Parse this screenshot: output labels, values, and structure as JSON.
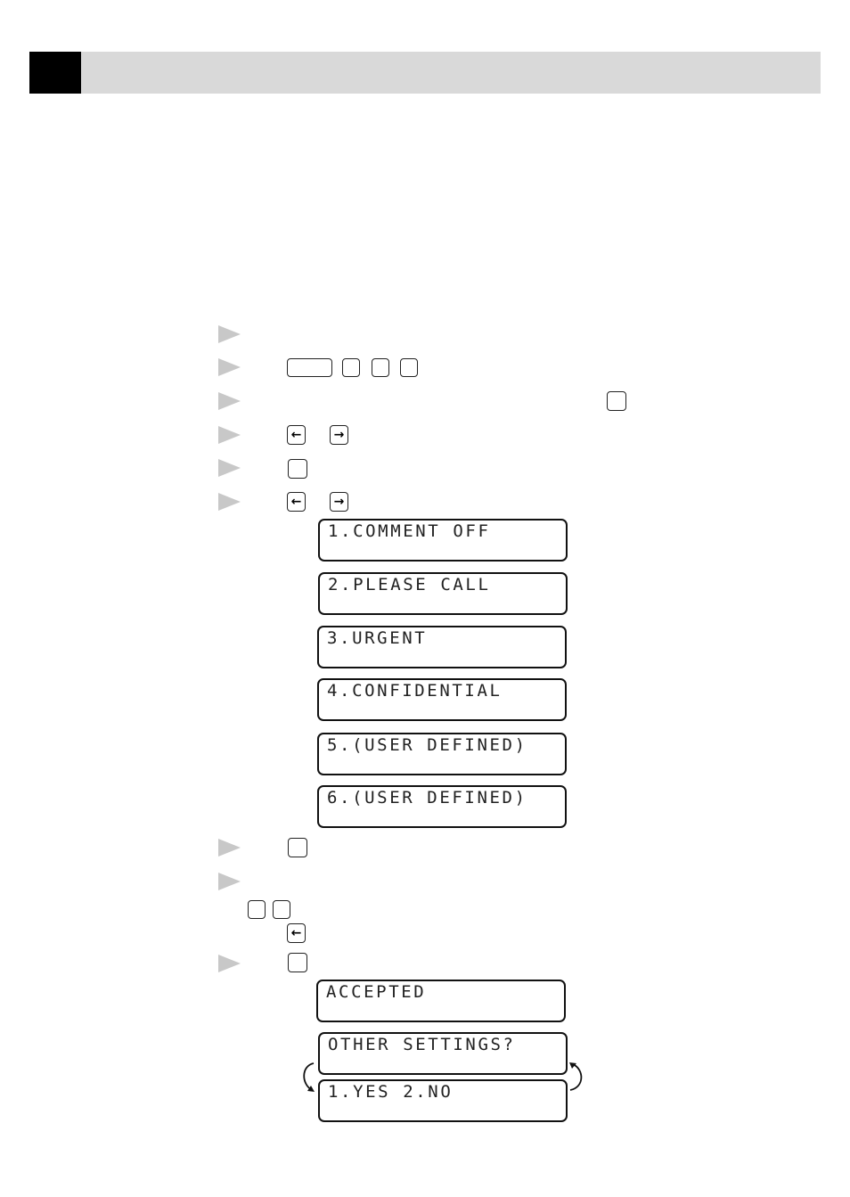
{
  "header": {
    "tab_color": "#000000",
    "bar_color": "#d9d9d9"
  },
  "steps": [
    {
      "bullet": "triangle-bullet",
      "keys": []
    },
    {
      "bullet": "triangle-bullet",
      "keys": [
        "blank-wide",
        "blank",
        "blank",
        "blank"
      ]
    },
    {
      "bullet": "triangle-bullet",
      "keys": [
        "blank"
      ]
    },
    {
      "bullet": "triangle-bullet",
      "keys": [
        "left-arrow",
        "right-arrow"
      ]
    },
    {
      "bullet": "triangle-bullet",
      "keys": [
        "blank"
      ]
    },
    {
      "bullet": "triangle-bullet",
      "keys": [
        "left-arrow",
        "right-arrow"
      ]
    },
    {
      "bullet": "triangle-bullet",
      "keys": [
        "blank"
      ]
    },
    {
      "bullet": "triangle-bullet",
      "keys": [
        "blank",
        "blank",
        "left-arrow"
      ]
    },
    {
      "bullet": "triangle-bullet",
      "keys": [
        "blank"
      ]
    }
  ],
  "keys": {
    "left_arrow": "←",
    "right_arrow": "→",
    "blank": ""
  },
  "lcd_options": [
    "1.COMMENT OFF",
    "2.PLEASE CALL",
    "3.URGENT",
    "4.CONFIDENTIAL",
    "5.(USER DEFINED)",
    "6.(USER DEFINED)"
  ],
  "lcd_result": {
    "accepted": "ACCEPTED",
    "other_settings": "OTHER SETTINGS?",
    "yes_no": "1.YES 2.NO"
  },
  "colors": {
    "bullet": "#c8c8c8",
    "lcd_border": "#111111",
    "lcd_text": "#222222"
  }
}
